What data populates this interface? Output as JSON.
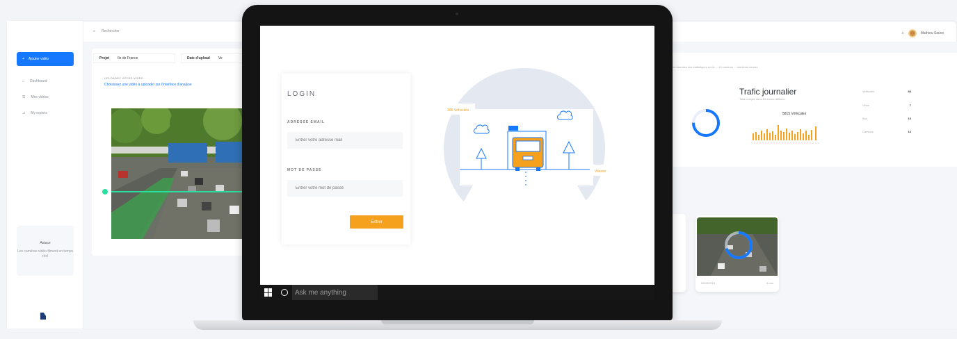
{
  "dashboard": {
    "topbar_search": "Rechercher",
    "add_button": "Ajouter vidéo",
    "nav": [
      {
        "icon": "home-icon",
        "label": "Dashboard"
      },
      {
        "icon": "list-icon",
        "label": "Mes vidéos"
      },
      {
        "icon": "chart-icon",
        "label": "My reports"
      }
    ],
    "info_card": {
      "title": "Astuce",
      "text": "Les caméras vidéo filment en temps réel"
    },
    "project_label": "Projet",
    "project_value": "Ile de France",
    "date_label": "Date d'upload",
    "date_value": "Ve",
    "upload_title": "UPLOADEZ VOTRE VIDÉO",
    "upload_link": "Choisissez une vidéo à uploader sur l'interface d'analyse",
    "stats_text": "Les données des statistiques sur la ... 10 caméras ... dernières heures",
    "traffic_title": "Trafic journalier",
    "traffic_subtitle": "Total compté dans les zones définies",
    "traffic_vehicles": "5815 Véhicules",
    "stat_rows": [
      {
        "label": "Véhicules",
        "value": "84"
      },
      {
        "label": "Vélos",
        "value": "7"
      },
      {
        "label": "Bus",
        "value": "10"
      },
      {
        "label": "Camions",
        "value": "16"
      }
    ],
    "camera_card": {
      "date": "09/05/2019",
      "time": "8 min"
    },
    "user_name": "Mathieu Sauve"
  },
  "login": {
    "title": "LOGIN",
    "email_label": "ADRESSE EMAIL",
    "email_placeholder": "Entrer votre adresse mail",
    "password_label": "MOT DE PASSE",
    "password_placeholder": "Entrer votre mot de passe",
    "submit_label": "Entrer",
    "tag_left": "300 Véhicules",
    "tag_right": "Vitesse"
  },
  "taskbar": {
    "search_placeholder": "Ask me anything"
  },
  "colors": {
    "accent_blue": "#1677ff",
    "accent_orange": "#f5a11d"
  }
}
